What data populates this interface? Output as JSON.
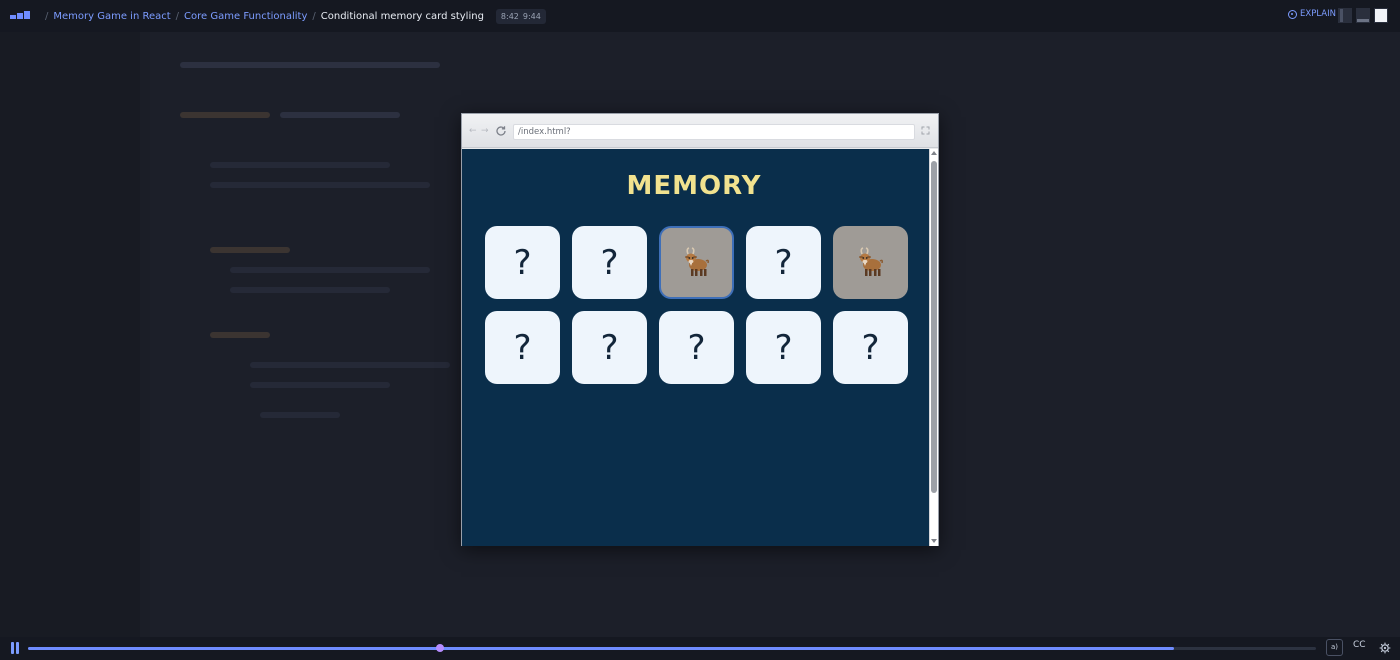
{
  "header": {
    "breadcrumbs": [
      {
        "label": "Memory Game in React"
      },
      {
        "label": "Core Game Functionality"
      }
    ],
    "current_lesson": "Conditional memory card styling",
    "time_current": "8:42",
    "time_total": "9:44",
    "explain_label": "EXPLAIN"
  },
  "browser": {
    "url": "/index.html?",
    "back_glyph": "←",
    "forward_glyph": "→"
  },
  "game": {
    "title": "MEMORY",
    "hidden_symbol": "?",
    "cards": [
      {
        "state": "hidden"
      },
      {
        "state": "hidden"
      },
      {
        "state": "flipped",
        "selected": true,
        "icon": "goat-emoji-icon"
      },
      {
        "state": "hidden"
      },
      {
        "state": "flipped",
        "selected": false,
        "icon": "goat-emoji-icon"
      },
      {
        "state": "hidden"
      },
      {
        "state": "hidden"
      },
      {
        "state": "hidden"
      },
      {
        "state": "hidden"
      },
      {
        "state": "hidden"
      }
    ]
  },
  "player": {
    "progress_fraction": 0.89,
    "marker_fraction": 0.32,
    "cc_label": "CC",
    "speech_label": "a)"
  },
  "colors": {
    "accent": "#7c9cff",
    "game_bg": "#0a2e4b",
    "title_color": "#f1e28f",
    "card_hidden": "#eef5fc",
    "card_flipped": "#9f9b96",
    "selected_border": "#3e6fb8"
  }
}
